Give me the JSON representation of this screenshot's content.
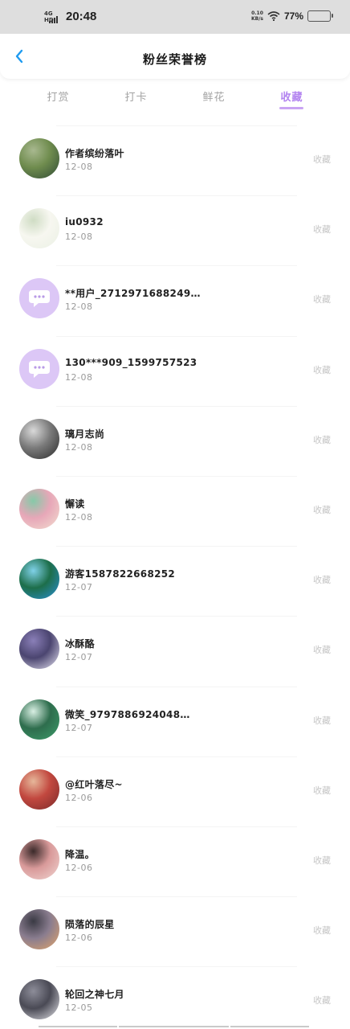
{
  "status_bar": {
    "network": "4G HD",
    "time": "20:48",
    "speed_value": "0.10",
    "speed_unit": "KB/s",
    "battery_percent": "77%",
    "battery_level": 0.77,
    "battery_color": "#f5b800"
  },
  "header": {
    "title": "粉丝荣誉榜",
    "back_icon": "chevron-left-icon",
    "accent_color": "#1e9bf0"
  },
  "tabs": [
    {
      "label": "打赏",
      "active": false
    },
    {
      "label": "打卡",
      "active": false
    },
    {
      "label": "鲜花",
      "active": false
    },
    {
      "label": "收藏",
      "active": true
    }
  ],
  "active_tab_color": "#b384f0",
  "fans": [
    {
      "name": "作者缤纷落叶",
      "date": "12-08",
      "action": "收藏",
      "avatar": "photo",
      "palette": [
        "#2f4a35",
        "#a8b88f",
        "#6f8c4e"
      ]
    },
    {
      "name": "iu0932",
      "date": "12-08",
      "action": "收藏",
      "avatar": "photo",
      "palette": [
        "#eaf0e4",
        "#cfdcc4",
        "#f7f7f0"
      ]
    },
    {
      "name": "**用户_2712971688249…",
      "date": "12-08",
      "action": "收藏",
      "avatar": "default",
      "palette": [
        "#dcc7f6",
        "#ffffff",
        "#b99be6"
      ]
    },
    {
      "name": "130***909_1599757523",
      "date": "12-08",
      "action": "收藏",
      "avatar": "default",
      "palette": [
        "#dcc7f6",
        "#ffffff",
        "#b99be6"
      ]
    },
    {
      "name": "璃月志尚",
      "date": "12-08",
      "action": "收藏",
      "avatar": "photo",
      "palette": [
        "#2a2a2a",
        "#d9d9d9",
        "#7a7a7a"
      ]
    },
    {
      "name": "懈读",
      "date": "12-08",
      "action": "收藏",
      "avatar": "photo",
      "palette": [
        "#f2dfd0",
        "#86c9a8",
        "#e7a7b8"
      ]
    },
    {
      "name": "游客1587822668252",
      "date": "12-07",
      "action": "收藏",
      "avatar": "photo",
      "palette": [
        "#2b8fd6",
        "#7fd1e8",
        "#1d6e4a"
      ]
    },
    {
      "name": "冰酥酪",
      "date": "12-07",
      "action": "收藏",
      "avatar": "photo",
      "palette": [
        "#e8e6f4",
        "#8a7fb8",
        "#4b4570"
      ]
    },
    {
      "name": "微笑_9797886924048…",
      "date": "12-07",
      "action": "收藏",
      "avatar": "photo",
      "palette": [
        "#3d9d6b",
        "#d8efe3",
        "#2e6d4d"
      ]
    },
    {
      "name": "@红叶落尽~",
      "date": "12-06",
      "action": "收藏",
      "avatar": "photo",
      "palette": [
        "#7a2a2a",
        "#e6b79a",
        "#c2483f"
      ]
    },
    {
      "name": "降温。",
      "date": "12-06",
      "action": "收藏",
      "avatar": "photo",
      "palette": [
        "#f0d6d2",
        "#3b2a2a",
        "#d99a9a"
      ]
    },
    {
      "name": "陨落的辰星",
      "date": "12-06",
      "action": "收藏",
      "avatar": "photo",
      "palette": [
        "#e3a56a",
        "#3a3a44",
        "#8a7d8f"
      ]
    },
    {
      "name": "轮回之神七月",
      "date": "12-05",
      "action": "收藏",
      "avatar": "photo",
      "palette": [
        "#e5e5ea",
        "#8d8d99",
        "#4a4a55"
      ]
    }
  ]
}
